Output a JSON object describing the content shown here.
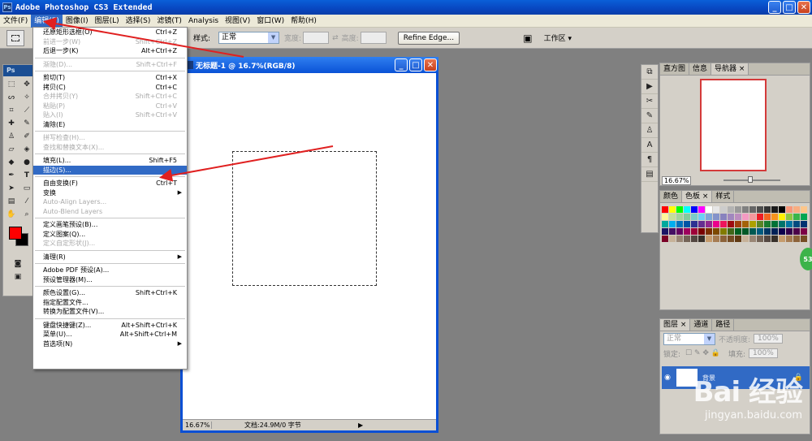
{
  "app": {
    "title": "Adobe Photoshop CS3 Extended",
    "logo": "Ps",
    "win_min": "_",
    "win_max": "□",
    "win_close": "✕"
  },
  "menubar": [
    "文件(F)",
    "编辑(E)",
    "图像(I)",
    "图层(L)",
    "选择(S)",
    "滤镜(T)",
    "Analysis",
    "视图(V)",
    "窗口(W)",
    "帮助(H)"
  ],
  "options": {
    "style_label": "样式:",
    "style_value": "正常",
    "width_label": "宽度:",
    "height_label": "高度:",
    "refine_edge": "Refine Edge...",
    "workspace": "工作区 ▾"
  },
  "edit_menu": [
    {
      "label": "还原矩形选框(O)",
      "shortcut": "Ctrl+Z",
      "enabled": true
    },
    {
      "label": "前进一步(W)",
      "shortcut": "Shift+Ctrl+Z",
      "enabled": false
    },
    {
      "label": "后退一步(K)",
      "shortcut": "Alt+Ctrl+Z",
      "enabled": true
    },
    {
      "sep": true
    },
    {
      "label": "渐隐(D)...",
      "shortcut": "Shift+Ctrl+F",
      "enabled": false
    },
    {
      "sep": true
    },
    {
      "label": "剪切(T)",
      "shortcut": "Ctrl+X",
      "enabled": true
    },
    {
      "label": "拷贝(C)",
      "shortcut": "Ctrl+C",
      "enabled": true
    },
    {
      "label": "合并拷贝(Y)",
      "shortcut": "Shift+Ctrl+C",
      "enabled": false
    },
    {
      "label": "粘贴(P)",
      "shortcut": "Ctrl+V",
      "enabled": false
    },
    {
      "label": "贴入(I)",
      "shortcut": "Shift+Ctrl+V",
      "enabled": false
    },
    {
      "label": "清除(E)",
      "shortcut": "",
      "enabled": true
    },
    {
      "sep": true
    },
    {
      "label": "拼写检查(H)...",
      "shortcut": "",
      "enabled": false
    },
    {
      "label": "查找和替换文本(X)...",
      "shortcut": "",
      "enabled": false
    },
    {
      "sep": true
    },
    {
      "label": "填充(L)...",
      "shortcut": "Shift+F5",
      "enabled": true
    },
    {
      "label": "描边(S)...",
      "shortcut": "",
      "enabled": true,
      "highlight": true
    },
    {
      "sep": true
    },
    {
      "label": "自由变换(F)",
      "shortcut": "Ctrl+T",
      "enabled": true
    },
    {
      "label": "变换",
      "shortcut": "",
      "enabled": true,
      "submenu": true
    },
    {
      "label": "Auto-Align Layers...",
      "shortcut": "",
      "enabled": false
    },
    {
      "label": "Auto-Blend Layers",
      "shortcut": "",
      "enabled": false
    },
    {
      "sep": true
    },
    {
      "label": "定义画笔预设(B)...",
      "shortcut": "",
      "enabled": true
    },
    {
      "label": "定义图案(Q)...",
      "shortcut": "",
      "enabled": true
    },
    {
      "label": "定义自定形状(J)...",
      "shortcut": "",
      "enabled": false
    },
    {
      "sep": true
    },
    {
      "label": "清理(R)",
      "shortcut": "",
      "enabled": true,
      "submenu": true
    },
    {
      "sep": true
    },
    {
      "label": "Adobe PDF 预设(A)...",
      "shortcut": "",
      "enabled": true
    },
    {
      "label": "预设管理器(M)...",
      "shortcut": "",
      "enabled": true
    },
    {
      "sep": true
    },
    {
      "label": "颜色设置(G)...",
      "shortcut": "Shift+Ctrl+K",
      "enabled": true
    },
    {
      "label": "指定配置文件...",
      "shortcut": "",
      "enabled": true
    },
    {
      "label": "转换为配置文件(V)...",
      "shortcut": "",
      "enabled": true
    },
    {
      "sep": true
    },
    {
      "label": "键盘快捷键(Z)...",
      "shortcut": "Alt+Shift+Ctrl+K",
      "enabled": true
    },
    {
      "label": "菜单(U)...",
      "shortcut": "Alt+Shift+Ctrl+M",
      "enabled": true
    },
    {
      "label": "首选项(N)",
      "shortcut": "",
      "enabled": true,
      "submenu": true
    }
  ],
  "document": {
    "title": "无标题-1 @ 16.7%(RGB/8)",
    "zoom": "16.67%",
    "info": "文档:24.9M/0 字节"
  },
  "panels": {
    "navigator_tabs": [
      "直方图",
      "信息",
      "导航器 ×"
    ],
    "navigator_zoom": "16.67%",
    "color_tabs": [
      "颜色",
      "色板 ×",
      "样式"
    ],
    "layers_tabs": [
      "图层 ×",
      "通道",
      "路径"
    ],
    "blend_mode": "正常",
    "opacity_label": "不透明度:",
    "opacity_value": "100%",
    "lock_label": "锁定:",
    "fill_label": "填充:",
    "fill_value": "100%",
    "layer_name": "背景"
  },
  "badge": "53",
  "watermark": {
    "logo": "Bai 经验",
    "url": "jingyan.baidu.com"
  },
  "swatch_colors": [
    "#ff0000",
    "#ffff00",
    "#00ff00",
    "#00ffff",
    "#0000ff",
    "#ff00ff",
    "#ffffff",
    "#e6e6e6",
    "#cccccc",
    "#b3b3b3",
    "#999999",
    "#808080",
    "#666666",
    "#4d4d4d",
    "#333333",
    "#1a1a1a",
    "#000000",
    "#f7977a",
    "#f9ad81",
    "#fdc68a",
    "#fff79a",
    "#c4df9b",
    "#a2d39c",
    "#82ca9d",
    "#7bcdc8",
    "#6ecff6",
    "#7ea7d8",
    "#8493ca",
    "#8882be",
    "#a187be",
    "#bc8dbf",
    "#f49ac2",
    "#f6989d",
    "#ed1c24",
    "#f26522",
    "#f7941d",
    "#fff200",
    "#8dc73f",
    "#39b54a",
    "#00a651",
    "#00a99d",
    "#00aeef",
    "#0072bc",
    "#0054a6",
    "#2e3192",
    "#662d91",
    "#92278f",
    "#ec008c",
    "#ed145b",
    "#9e0b0f",
    "#a0410d",
    "#a36209",
    "#aba000",
    "#598527",
    "#1a7b30",
    "#007236",
    "#00746b",
    "#0076a3",
    "#004b80",
    "#003471",
    "#1b1464",
    "#440e62",
    "#630460",
    "#9e005d",
    "#9e0039",
    "#790000",
    "#7b2e00",
    "#7d4900",
    "#827b00",
    "#406618",
    "#005e20",
    "#005826",
    "#005952",
    "#005b7f",
    "#003663",
    "#002157",
    "#0d004c",
    "#32004b",
    "#4b0049",
    "#7b0046",
    "#7a0026",
    "#c7b299",
    "#998675",
    "#736357",
    "#534741",
    "#37302a",
    "#c69c6d",
    "#a67c52",
    "#8c6239",
    "#754c24",
    "#603913",
    "#c7b299",
    "#998675",
    "#736357",
    "#534741",
    "#37302a",
    "#c69c6d",
    "#a67c52",
    "#8c6239",
    "#754c24"
  ]
}
